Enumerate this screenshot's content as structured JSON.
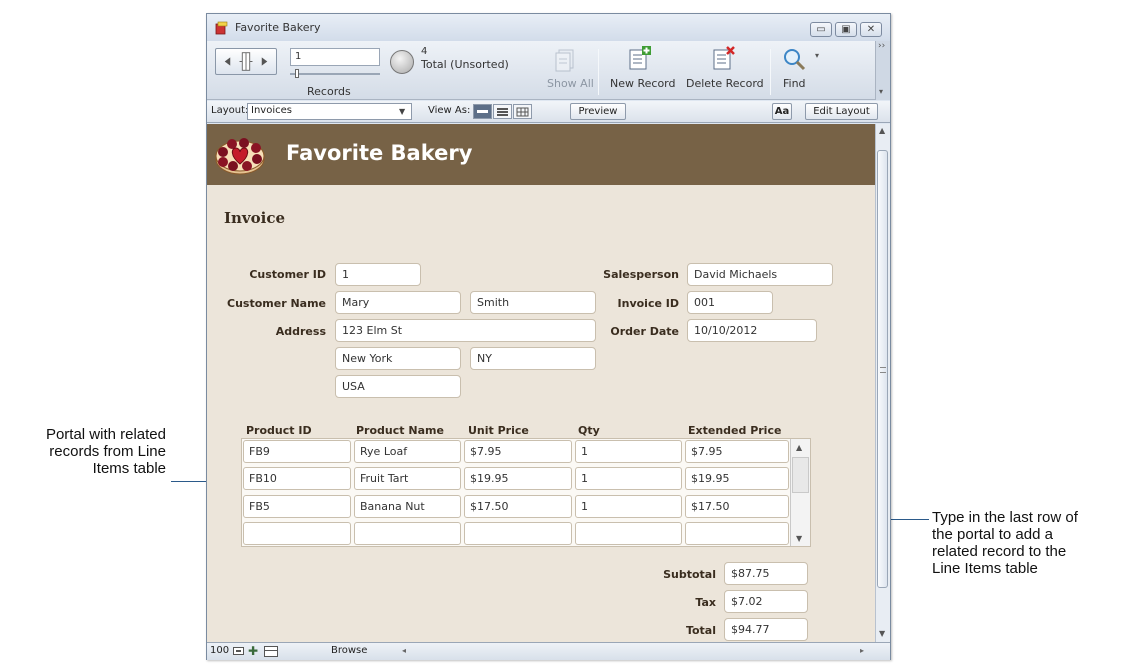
{
  "window": {
    "title": "Favorite Bakery"
  },
  "titlebar_buttons": [
    "minimize",
    "restore",
    "close"
  ],
  "toolbar": {
    "record_number": "1",
    "records_label": "Records",
    "found_count": "4",
    "total_label": "Total (Unsorted)",
    "show_all_label": "Show All",
    "new_record_label": "New Record",
    "delete_record_label": "Delete Record",
    "find_label": "Find"
  },
  "layoutbar": {
    "layout_label": "Layout:",
    "layout_value": "Invoices",
    "view_as_label": "View As:",
    "preview_label": "Preview",
    "aa_label": "Aa",
    "edit_layout_label": "Edit Layout"
  },
  "header": {
    "company_name": "Favorite Bakery"
  },
  "invoice": {
    "title": "Invoice",
    "labels": {
      "customer_id": "Customer ID",
      "customer_name": "Customer Name",
      "address": "Address",
      "salesperson": "Salesperson",
      "invoice_id": "Invoice ID",
      "order_date": "Order Date"
    },
    "values": {
      "customer_id": "1",
      "first_name": "Mary",
      "last_name": "Smith",
      "street": "123 Elm St",
      "city": "New York",
      "state": "NY",
      "country": "USA",
      "salesperson": "David Michaels",
      "invoice_id": "001",
      "order_date": "10/10/2012"
    }
  },
  "portal": {
    "columns": [
      "Product ID",
      "Product Name",
      "Unit Price",
      "Qty",
      "Extended Price"
    ],
    "rows": [
      [
        "FB9",
        "Rye Loaf",
        "$7.95",
        "1",
        "$7.95"
      ],
      [
        "FB10",
        "Fruit Tart",
        "$19.95",
        "1",
        "$19.95"
      ],
      [
        "FB5",
        "Banana Nut",
        "$17.50",
        "1",
        "$17.50"
      ],
      [
        "",
        "",
        "",
        "",
        ""
      ]
    ]
  },
  "totals": {
    "subtotal_label": "Subtotal",
    "subtotal": "$87.75",
    "tax_label": "Tax",
    "tax": "$7.02",
    "total_label": "Total",
    "total": "$94.77"
  },
  "bottombar": {
    "zoom": "100",
    "mode": "Browse"
  },
  "callouts": {
    "left": [
      "Portal with related",
      "records from Line",
      "Items table"
    ],
    "right": [
      "Type in the last row of",
      "the portal to add a",
      "related record to the",
      "Line Items table"
    ]
  },
  "colors": {
    "header_band": "#776246",
    "body_bg": "#ece5da",
    "callout_line": "#2b5a8a"
  }
}
